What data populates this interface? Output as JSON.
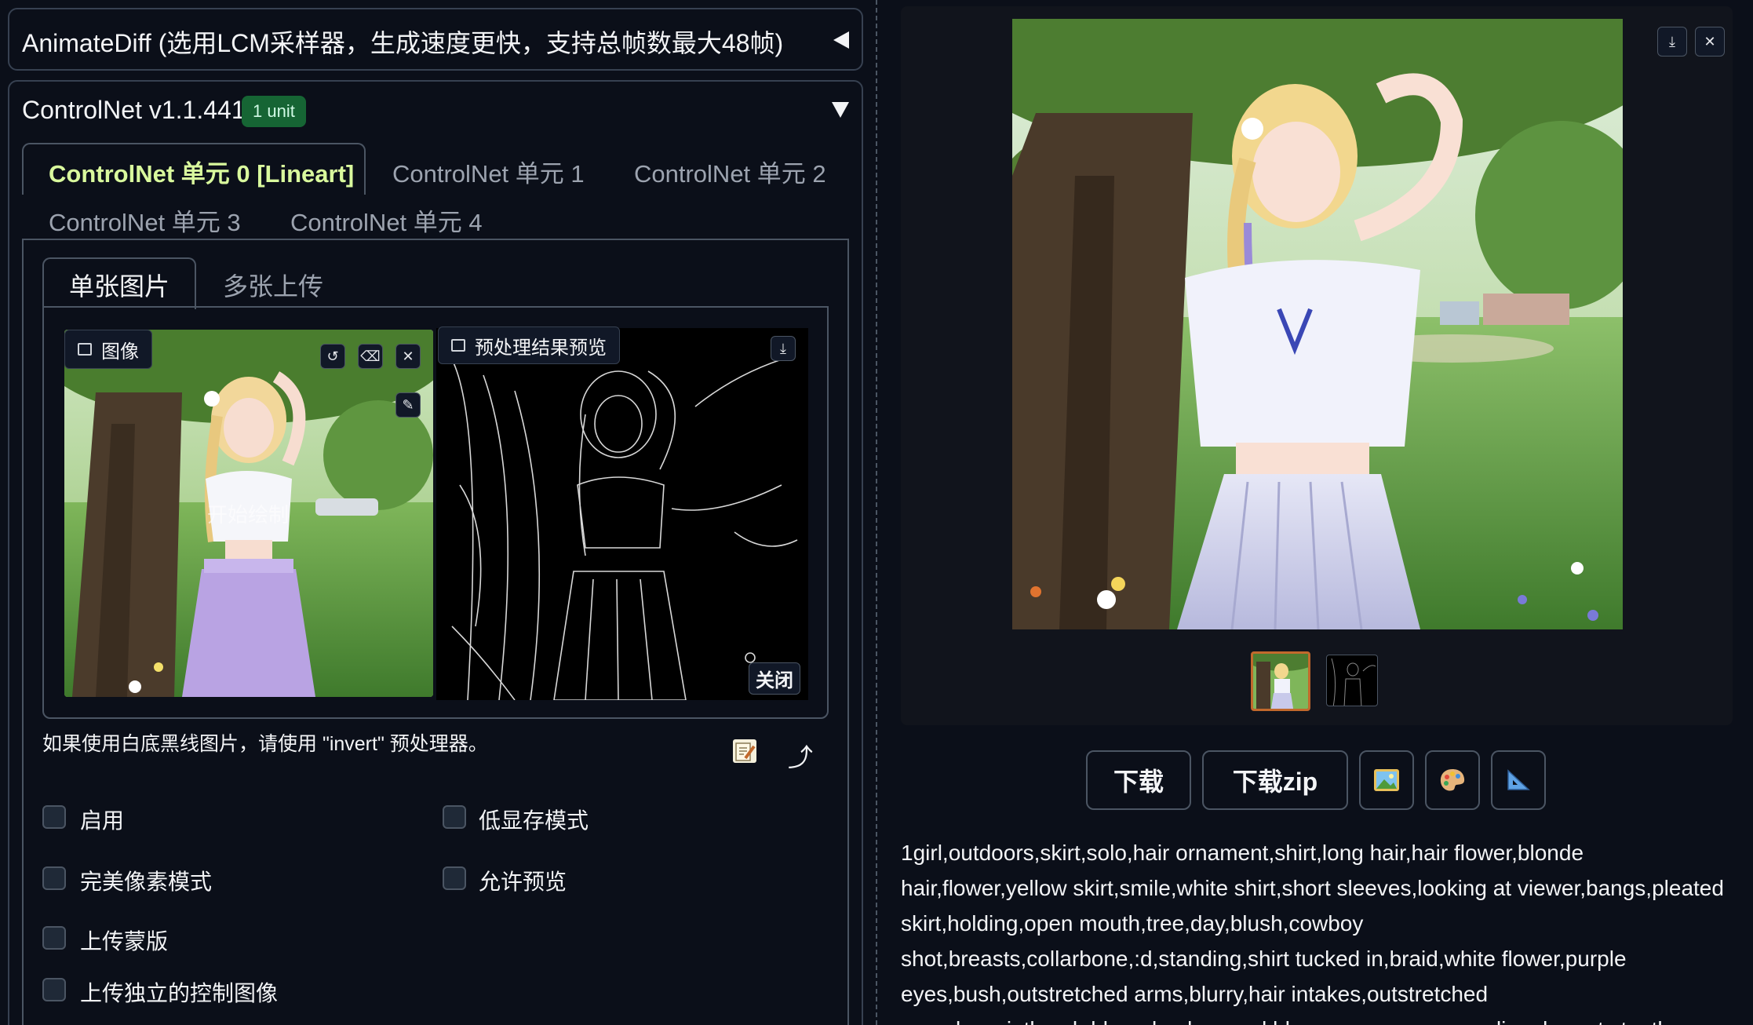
{
  "animatediff": {
    "title": "AnimateDiff (选用LCM采样器，生成速度更快，支持总帧数最大48帧)"
  },
  "controlnet": {
    "title": "ControlNet v1.1.441",
    "badge": "1 unit",
    "tabs": [
      {
        "label": "ControlNet 单元 0 [Lineart]",
        "active": true
      },
      {
        "label": "ControlNet 单元 1"
      },
      {
        "label": "ControlNet 单元 2"
      },
      {
        "label": "ControlNet 单元 3"
      },
      {
        "label": "ControlNet 单元 4"
      }
    ],
    "subtabs": [
      {
        "label": "单张图片",
        "active": true
      },
      {
        "label": "多张上传"
      }
    ],
    "image_label": "图像",
    "overlay_text": "开始绘制",
    "preview_label": "预处理结果预览",
    "close_label": "关闭",
    "hint": "如果使用白底黑线图片，请使用 \"invert\" 预处理器。",
    "checkboxes": [
      {
        "label": "启用",
        "checked": true
      },
      {
        "label": "低显存模式",
        "checked": false
      },
      {
        "label": "完美像素模式",
        "checked": true
      },
      {
        "label": "允许预览",
        "checked": true
      },
      {
        "label": "上传蒙版",
        "checked": false
      },
      {
        "label": "上传独立的控制图像",
        "checked": true
      }
    ]
  },
  "output": {
    "buttons": {
      "download": "下载",
      "download_zip": "下载zip"
    },
    "tool_icons": [
      "image-icon",
      "palette-icon",
      "ruler-icon"
    ],
    "prompt": "1girl,outdoors,skirt,solo,hair ornament,shirt,long hair,hair flower,blonde hair,flower,yellow skirt,smile,white shirt,short sleeves,looking at viewer,bangs,pleated skirt,holding,open mouth,tree,day,blush,cowboy shot,breasts,collarbone,:d,standing,shirt tucked in,braid,white flower,purple eyes,bush,outstretched arms,blurry,hair intakes,outstretched arm,sky,paintbrush,blurry background,blue eyes,arms up,medium breasts,teeth,"
  },
  "colors": {
    "accent": "#d9f99d",
    "checkbox": "#3b5fd9",
    "badge": "#166534",
    "thumb_border": "#c2692c"
  }
}
